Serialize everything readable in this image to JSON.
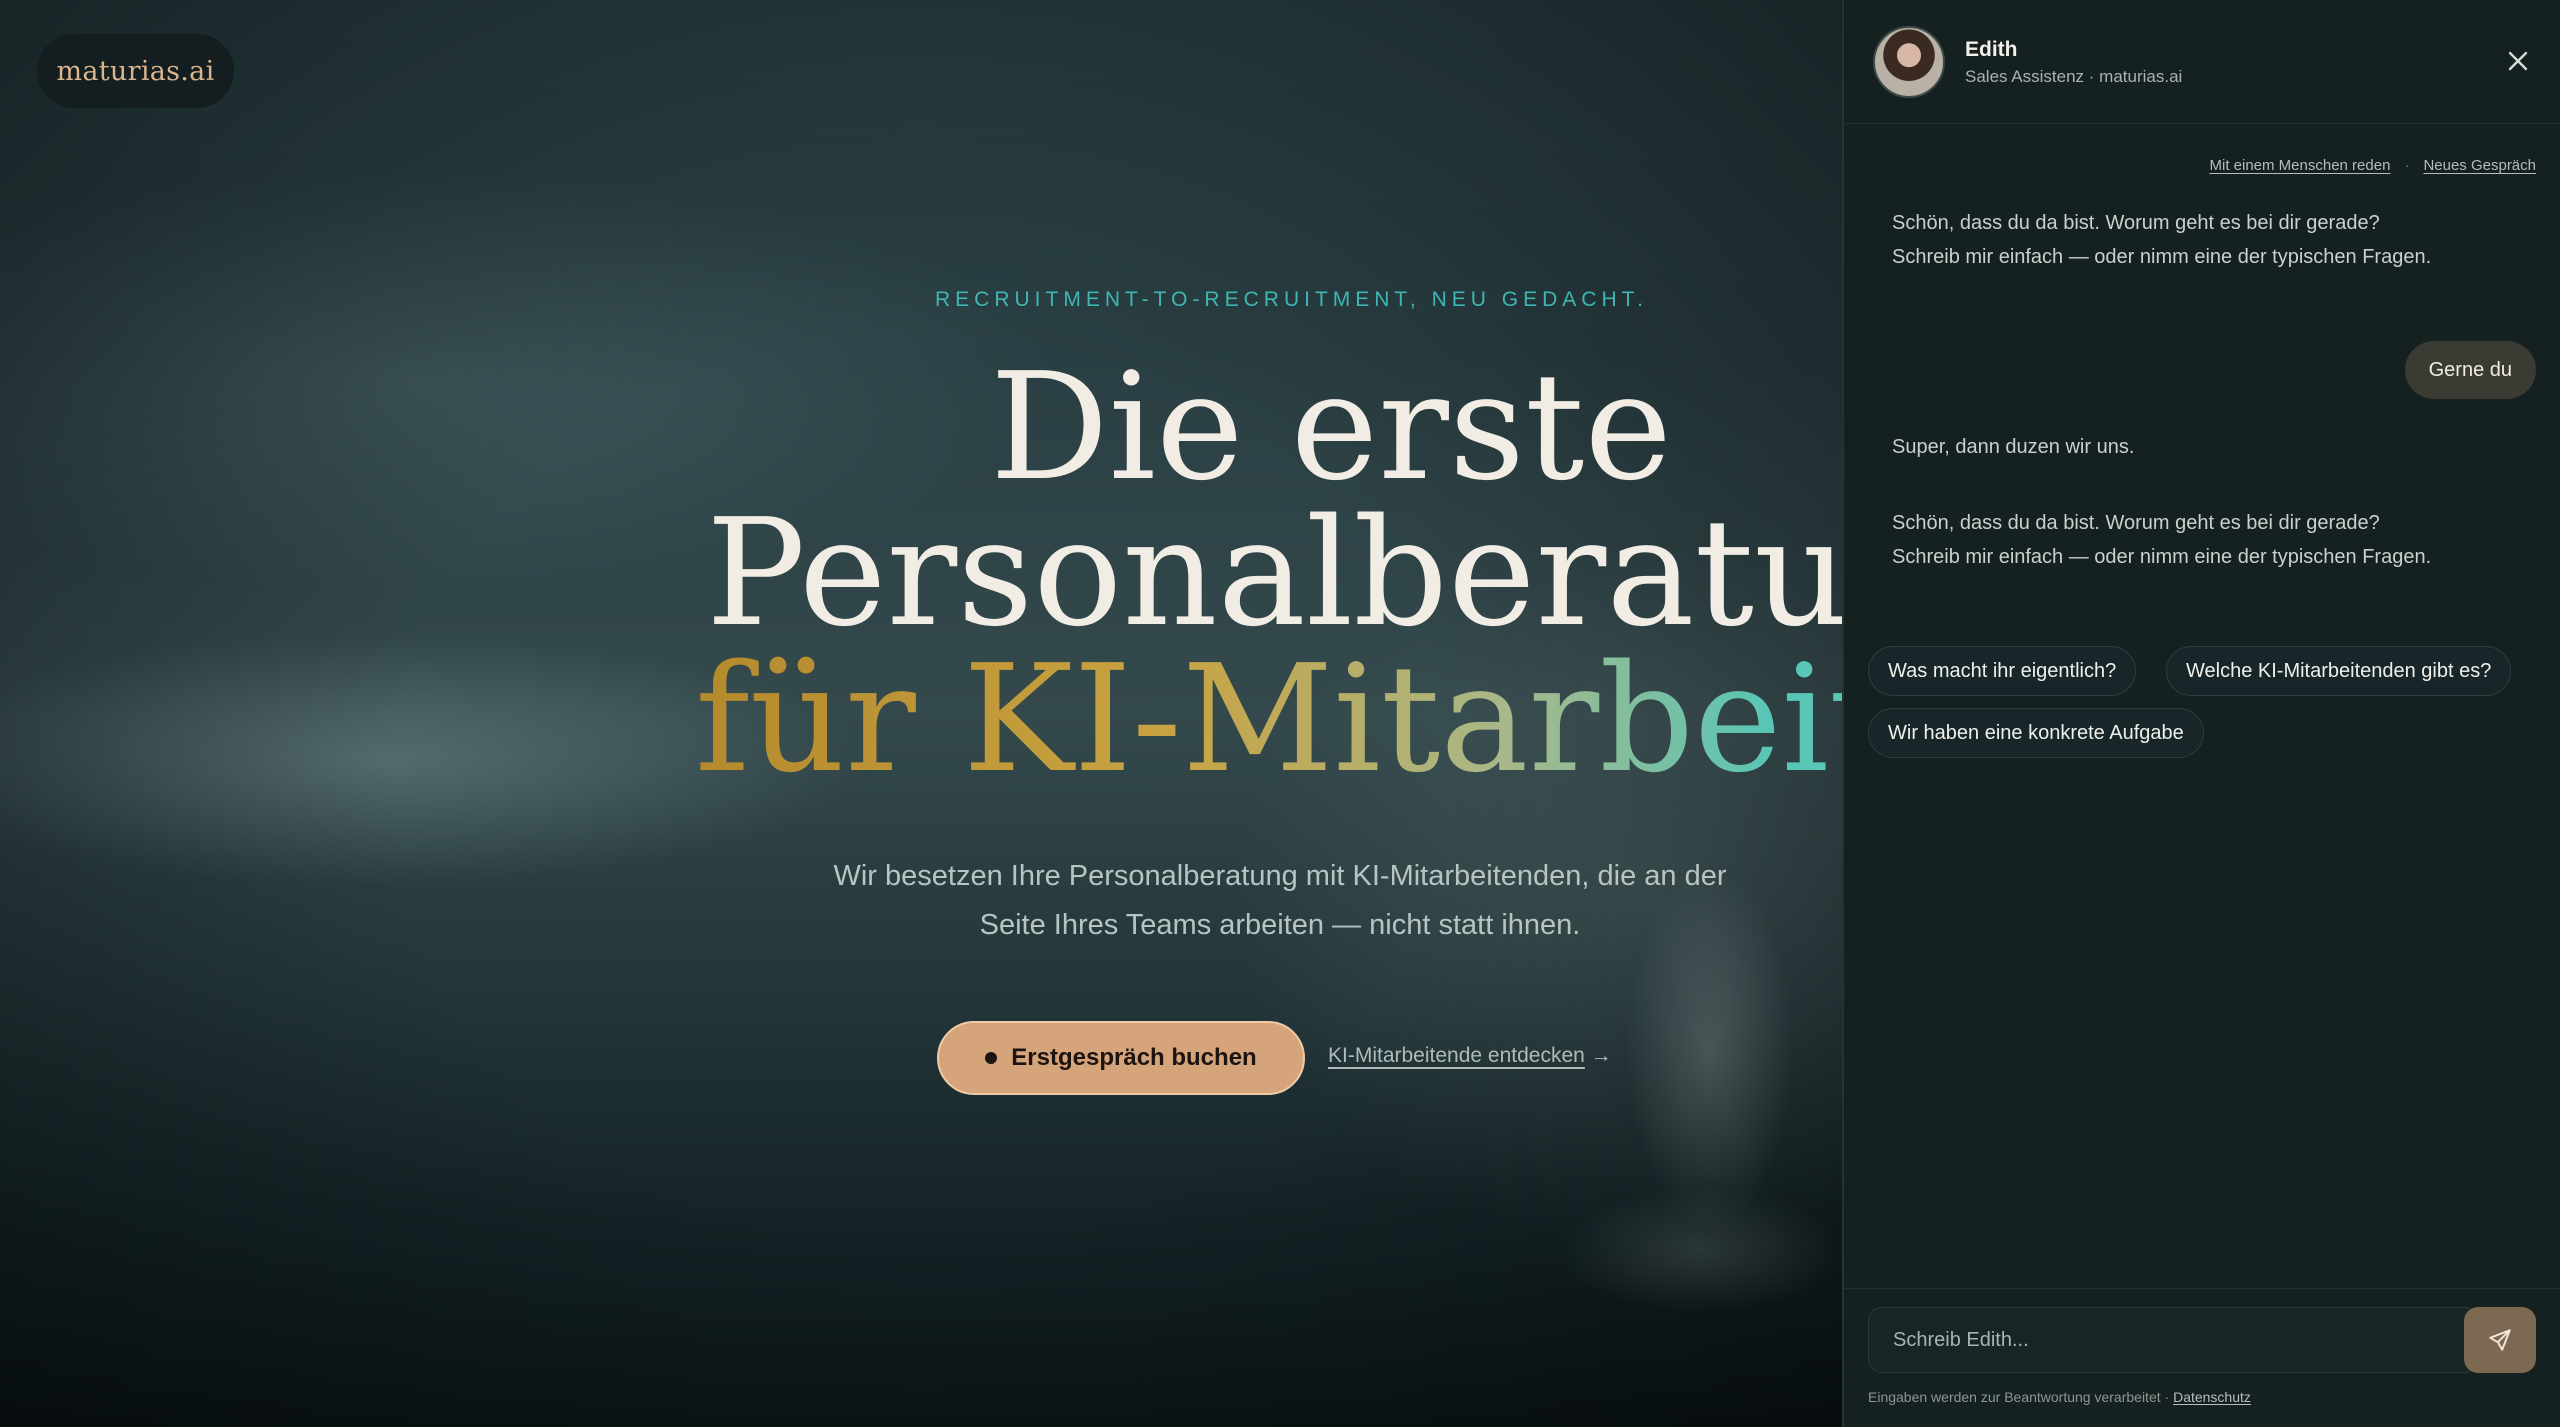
{
  "hero": {
    "logo": "maturias.ai",
    "eyebrow": "RECRUITMENT-TO-RECRUITMENT, NEU GEDACHT.",
    "headline_line1": "Die erste",
    "headline_line2": "Personalberatung",
    "headline_line3": "für KI-Mitarbeiter",
    "subline_line1": "Wir besetzen Ihre Personalberatung mit KI-Mitarbeitenden, die an der",
    "subline_line2": "Seite Ihres Teams arbeiten — nicht statt ihnen.",
    "cta_label": "Erstgespräch buchen",
    "secondary_link": "KI-Mitarbeitende entdecken",
    "secondary_arrow": "→",
    "gradient_colors": [
      "#b48a2c",
      "#c9a342",
      "#a8b889",
      "#56c6b7"
    ]
  },
  "chat": {
    "agent_name": "Edith",
    "agent_role": "Sales Assistenz · maturias.ai",
    "link_human": "Mit einem Menschen reden",
    "link_separator": "·",
    "link_new": "Neues Gespräch",
    "messages": [
      {
        "role": "bot",
        "text": "Schön, dass du da bist. Worum geht es bei dir gerade? Schreib mir einfach — oder nimm eine der typischen Fragen."
      },
      {
        "role": "user",
        "text": "Gerne du"
      },
      {
        "role": "bot",
        "text": "Super, dann duzen wir uns."
      },
      {
        "role": "bot",
        "text": "Schön, dass du da bist. Worum geht es bei dir gerade? Schreib mir einfach — oder nimm eine der typischen Fragen."
      }
    ],
    "suggestions": [
      "Was macht ihr eigentlich?",
      "Welche KI-Mitarbeitenden gibt es?",
      "Wir haben eine konkrete Aufgabe"
    ],
    "input_placeholder": "Schreib Edith...",
    "footnote_text": "Eingaben werden zur Beantwortung verarbeitet · ",
    "footnote_link": "Datenschutz",
    "accent_color": "#d5a47a"
  }
}
